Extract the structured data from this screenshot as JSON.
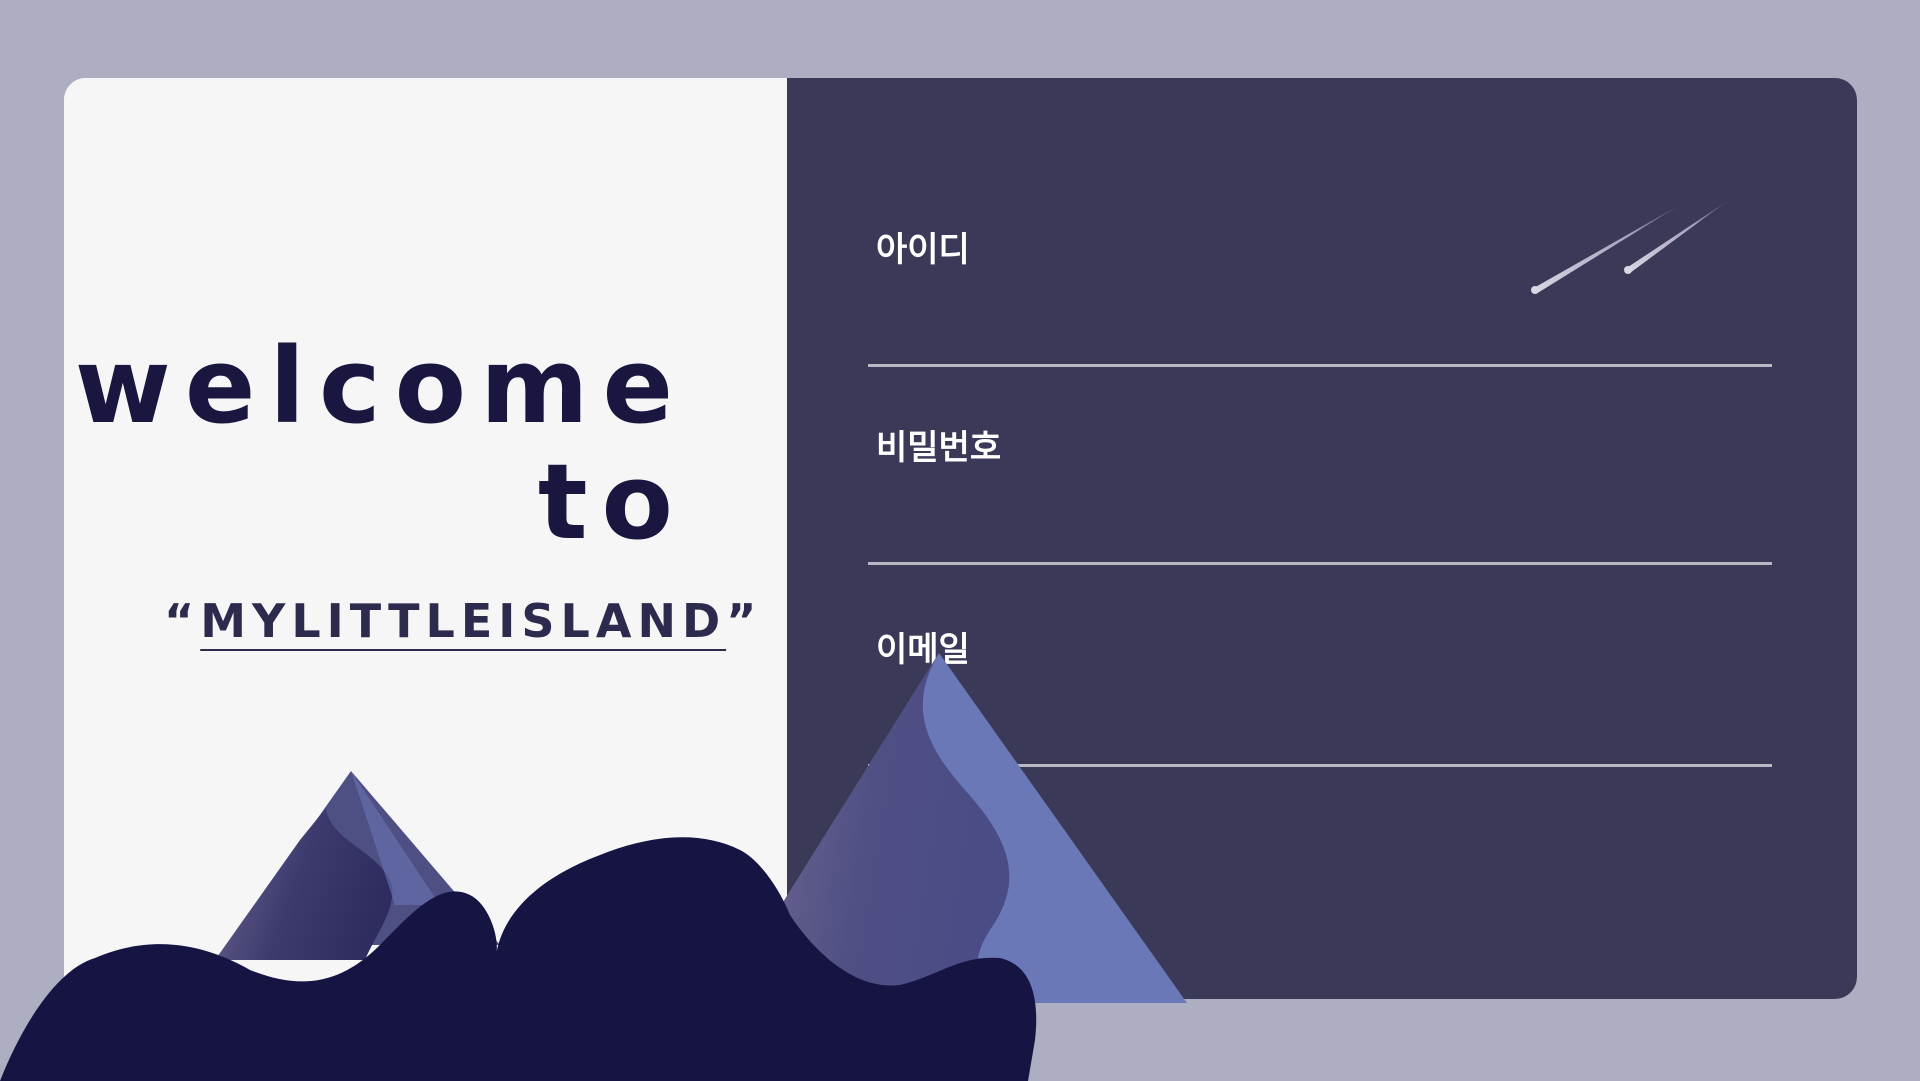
{
  "welcome": {
    "line1": "welcome",
    "line2": "to"
  },
  "island": {
    "open_quote": "“",
    "name": "MYLITTLEISLAND",
    "close_quote": "”"
  },
  "form": {
    "id_label": "아이디",
    "password_label": "비밀번호",
    "email_label": "이메일"
  },
  "colors": {
    "page_background": "#adaec1",
    "left_panel": "#f6f6f7",
    "right_panel": "#3a3a58",
    "title_text": "#19173f",
    "hills": "#161442",
    "mountain_light": "#6b78b8",
    "mountain_shadow": "#4f4f80",
    "input_underline": "#b8b8c4"
  },
  "icons": {
    "shooting_stars": "shooting-stars-icon",
    "mountains": "mountain-illustration",
    "hills": "hills-illustration"
  }
}
